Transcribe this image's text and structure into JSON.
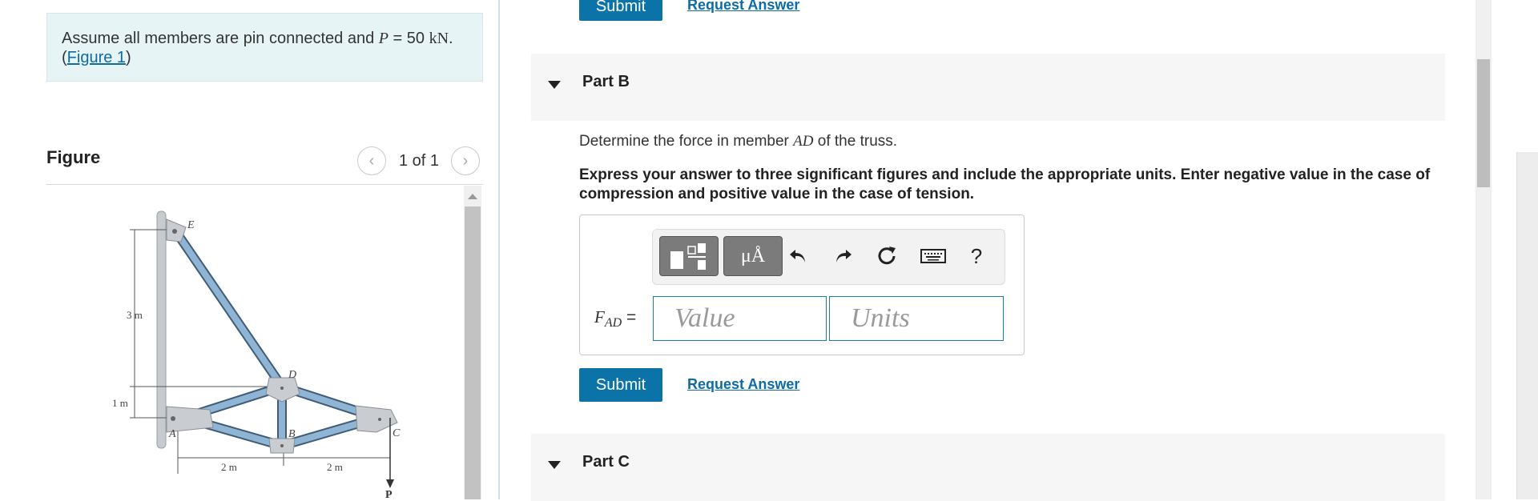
{
  "problem": {
    "text_prefix": "Assume all members are pin connected and ",
    "var_P": "P",
    "equals": " = 50 ",
    "unit_kN": "kN",
    "period": ".",
    "open_paren": "(",
    "figure_link": "Figure 1",
    "close_paren": ")"
  },
  "figure_panel": {
    "title": "Figure",
    "counter": "1 of 1",
    "labels": {
      "E": "E",
      "D": "D",
      "B": "B",
      "A": "A",
      "C": "C",
      "P": "P",
      "dim_3m": "3 m",
      "dim_1m": "1 m",
      "dim_2m_left": "2 m",
      "dim_2m_right": "2 m"
    }
  },
  "part_a_actions": {
    "submit_label": "Submit",
    "request_answer_label": "Request Answer"
  },
  "part_b": {
    "label": "Part B",
    "question_prefix": "Determine the force in member ",
    "question_var": "AD",
    "question_suffix": " of the truss.",
    "instructions": "Express your answer to three significant figures and include the appropriate units. Enter negative value in the case of compression and positive value in the case of tension.",
    "toolbar": {
      "units_button": "μÅ",
      "help": "?"
    },
    "answer_label_F": "F",
    "answer_label_sub": "AD",
    "answer_label_eq": " =",
    "value_placeholder": "Value",
    "units_placeholder": "Units",
    "submit_label": "Submit",
    "request_answer_label": "Request Answer"
  },
  "part_c": {
    "label": "Part C"
  },
  "colors": {
    "accent": "#0b73a8",
    "link": "#0d6ba6",
    "problem_bg": "#e6f4f6",
    "member_blue": "#7da6c9"
  },
  "icons": [
    "templates-icon",
    "undo-icon",
    "redo-icon",
    "reset-icon",
    "keyboard-icon",
    "help-icon",
    "chevron-left-icon",
    "chevron-right-icon",
    "collapse-triangle-icon"
  ]
}
